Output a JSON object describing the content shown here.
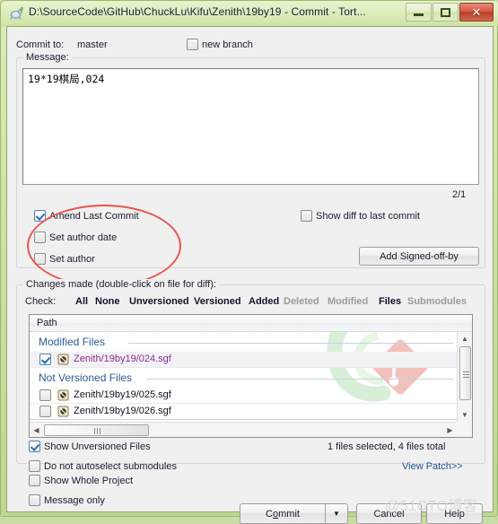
{
  "window": {
    "title": "D:\\SourceCode\\GitHub\\ChuckLu\\Kifu\\Zenith\\19by19 - Commit - Tort...",
    "icon": "tortoisegit-icon",
    "minimize_label": "",
    "maximize_label": "",
    "close_label": "✕"
  },
  "commit_to": {
    "label": "Commit to:",
    "branch": "master",
    "new_branch_label": "new branch",
    "new_branch_checked": false
  },
  "message": {
    "group_label": "Message:",
    "text": "19*19棋局,024",
    "counter": "2/1"
  },
  "options": {
    "amend_last_commit": {
      "label": "Amend Last Commit",
      "checked": true
    },
    "set_author_date": {
      "label": "Set author date",
      "checked": false
    },
    "set_author": {
      "label": "Set author",
      "checked": false
    },
    "show_diff_last_commit": {
      "label": "Show diff to last commit",
      "checked": false
    },
    "add_signed_off_by": "Add Signed-off-by"
  },
  "changes": {
    "group_label": "Changes made (double-click on file for diff):",
    "check_label": "Check:",
    "check_links": [
      {
        "label": "All",
        "enabled": true
      },
      {
        "label": "None",
        "enabled": true
      },
      {
        "label": "Unversioned",
        "enabled": true
      },
      {
        "label": "Versioned",
        "enabled": true
      },
      {
        "label": "Added",
        "enabled": true
      },
      {
        "label": "Deleted",
        "enabled": false
      },
      {
        "label": "Modified",
        "enabled": false
      },
      {
        "label": "Files",
        "enabled": true
      },
      {
        "label": "Submodules",
        "enabled": false
      }
    ],
    "column_header": "Path",
    "groups": [
      {
        "name": "Modified Files",
        "rows": [
          {
            "path": "Zenith/19by19/024.sgf",
            "checked": true,
            "style": "mod",
            "icon": "modified-file-icon"
          }
        ]
      },
      {
        "name": "Not Versioned Files",
        "rows": [
          {
            "path": "Zenith/19by19/025.sgf",
            "checked": false,
            "style": "unv",
            "icon": "unversioned-file-icon"
          },
          {
            "path": "Zenith/19by19/026.sgf",
            "checked": false,
            "style": "unv",
            "icon": "unversioned-file-icon"
          }
        ]
      }
    ],
    "status_text": "1 files selected, 4 files total",
    "view_patch": "View Patch>>",
    "show_unversioned": {
      "label": "Show Unversioned Files",
      "checked": true
    },
    "no_autoselect_submodules": {
      "label": "Do not autoselect submodules",
      "checked": false
    }
  },
  "footer": {
    "show_whole_project": {
      "label": "Show Whole Project",
      "checked": false
    },
    "message_only": {
      "label": "Message only",
      "checked": false
    },
    "commit_button": {
      "pre": "C",
      "accel": "o",
      "post": "mmit"
    },
    "commit_full": "Commit",
    "cancel_button": "Cancel",
    "help_button": "Help"
  },
  "watermark": {
    "text": "@51CTO博客",
    "logo": "tortoisegit-logo"
  },
  "colors": {
    "frame": "#cfe2a6",
    "accent_link": "#21559b",
    "modified_file": "#8b2f8b",
    "group_header": "#2e5d8f",
    "annotation": "#e8564b",
    "close_button": "#bc3d26"
  }
}
